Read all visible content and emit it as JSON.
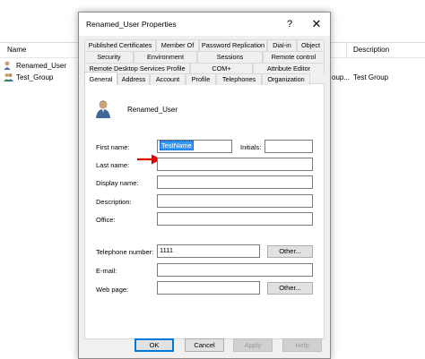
{
  "background": {
    "columns": {
      "name": "Name",
      "description": "Description"
    },
    "rows": [
      {
        "name": "Renamed_User",
        "type": "",
        "description": ""
      },
      {
        "name": "Test_Group",
        "type": "oup...",
        "description": "Test Group"
      }
    ]
  },
  "dialog": {
    "title": "Renamed_User Properties",
    "help": "?",
    "close": "✕",
    "tabs_row1": [
      "Published Certificates",
      "Member Of",
      "Password Replication",
      "Dial-in",
      "Object"
    ],
    "tabs_row2": [
      "Security",
      "Environment",
      "Sessions",
      "Remote control"
    ],
    "tabs_row3": [
      "Remote Desktop Services Profile",
      "COM+",
      "Attribute Editor"
    ],
    "tabs_row4": [
      "General",
      "Address",
      "Account",
      "Profile",
      "Telephones",
      "Organization"
    ],
    "user_display": "Renamed_User",
    "fields": {
      "first_name_label": "First name:",
      "first_name_value": "TestName",
      "initials_label": "Initials:",
      "last_name_label": "Last name:",
      "display_name_label": "Display name:",
      "description_label": "Description:",
      "office_label": "Office:",
      "telephone_label": "Telephone number:",
      "telephone_value": "1111",
      "email_label": "E-mail:",
      "webpage_label": "Web page:",
      "other_label": "Other..."
    },
    "buttons": {
      "ok": "OK",
      "cancel": "Cancel",
      "apply": "Apply",
      "help": "Help"
    },
    "colors": {
      "selection": "#3399ff",
      "arrow": "#e00000",
      "accent": "#0078d7"
    }
  }
}
